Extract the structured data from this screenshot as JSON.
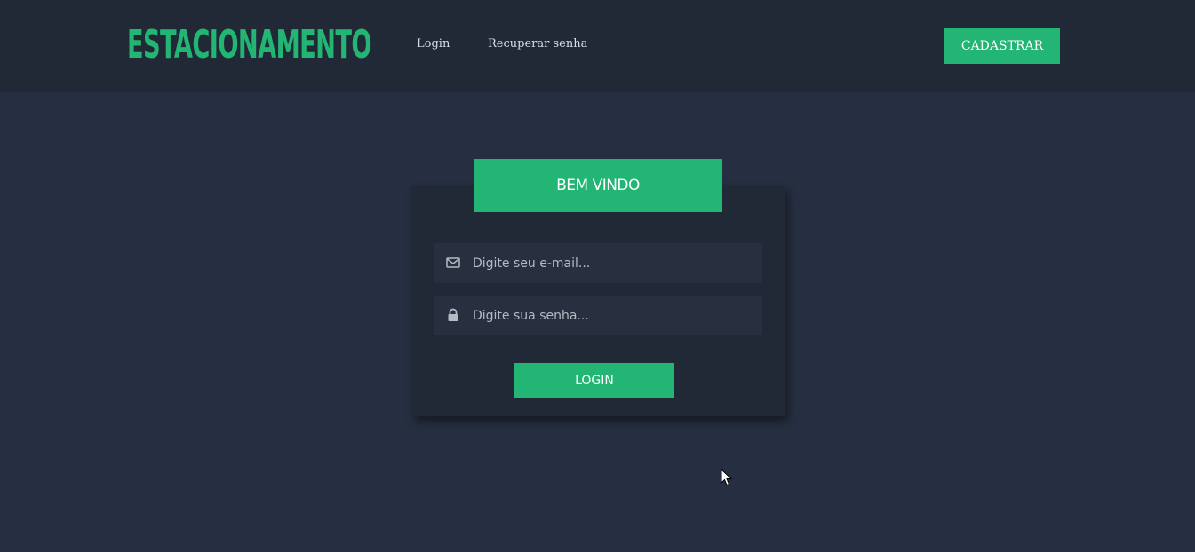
{
  "header": {
    "brand": "ESTACIONAMENTO",
    "nav": [
      {
        "label": "Login"
      },
      {
        "label": "Recuperar senha"
      }
    ],
    "signup_label": "CADASTRAR"
  },
  "login_card": {
    "title": "BEM VINDO",
    "email": {
      "placeholder": "Digite seu e-mail...",
      "value": "",
      "icon": "envelope-icon"
    },
    "password": {
      "placeholder": "Digite sua senha...",
      "value": "",
      "icon": "lock-icon"
    },
    "submit_label": "LOGIN"
  },
  "colors": {
    "accent": "#22b573",
    "header_bg": "#212836",
    "page_bg": "#262f41",
    "card_bg": "#212836",
    "field_bg": "#282f3e"
  }
}
